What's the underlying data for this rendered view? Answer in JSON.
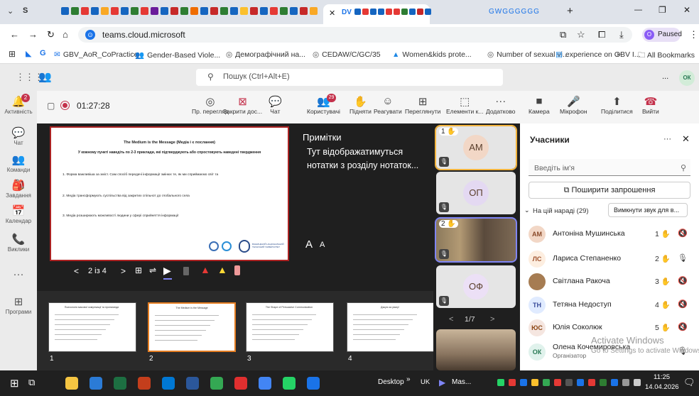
{
  "browser": {
    "url": "teams.cloud.microsoft",
    "paused_label": "Paused",
    "active_tab_initials": "DV",
    "tab_g_letters": "GWGGGGGG",
    "add_tab": "+",
    "win_min": "—",
    "win_max": "❐",
    "win_close": "✕",
    "bookmarks": [
      "GBV_AoR_CoPractice",
      "Gender-Based Viole...",
      "Демографічний на...",
      "CEDAW/C/GC/35",
      "Women&kids prote...",
      "Number of sexual vi...",
      "experience on GBV I..."
    ],
    "bookmarks_more": "»",
    "all_bookmarks": "All Bookmarks"
  },
  "teams": {
    "search_placeholder": "Пошук (Ctrl+Alt+E)",
    "more": "...",
    "profile_initials": "ОК"
  },
  "rail": [
    {
      "icon": "bell-icon",
      "glyph": "🔔",
      "label": "Активність",
      "badge": "2"
    },
    {
      "icon": "chat-icon",
      "glyph": "💬",
      "label": "Чат"
    },
    {
      "icon": "teams-icon",
      "glyph": "👥",
      "label": "Команди"
    },
    {
      "icon": "assignments-icon",
      "glyph": "🎒",
      "label": "Завдання"
    },
    {
      "icon": "calendar-icon",
      "glyph": "📅",
      "label": "Календар"
    },
    {
      "icon": "calls-icon",
      "glyph": "📞",
      "label": "Виклики"
    },
    {
      "icon": "more-icon",
      "glyph": "···",
      "label": ""
    },
    {
      "icon": "apps-icon",
      "glyph": "⊞",
      "label": "Програми"
    }
  ],
  "meeting": {
    "timer": "01:27:28",
    "buttons": [
      {
        "name": "viewer-mode",
        "glyph": "◎",
        "label": "Пр. перегляд"
      },
      {
        "name": "close-share",
        "glyph": "⊠",
        "label": "Закрити дос..."
      },
      {
        "name": "chat",
        "glyph": "💬",
        "label": "Чат"
      },
      {
        "name": "people",
        "glyph": "👥",
        "label": "Користувачі",
        "badge": "29"
      },
      {
        "name": "raise-hand",
        "glyph": "✋",
        "label": "Підняти"
      },
      {
        "name": "react",
        "glyph": "☺",
        "label": "Реагувати"
      },
      {
        "name": "view",
        "glyph": "⊞",
        "label": "Переглянути"
      },
      {
        "name": "elements",
        "glyph": "⬚",
        "label": "Елементи к..."
      },
      {
        "name": "more",
        "glyph": "···",
        "label": "Додатково"
      },
      {
        "name": "camera",
        "glyph": "■",
        "label": "Камера"
      },
      {
        "name": "mic",
        "glyph": "🎤",
        "label": "Мікрофон"
      },
      {
        "name": "share",
        "glyph": "⬆",
        "label": "Поділитися"
      },
      {
        "name": "leave",
        "glyph": "☎",
        "label": "Вийти"
      }
    ]
  },
  "slide": {
    "title": "The Medium is the Message (Медіа і є послання)",
    "subtitle": "У кожному пункті наведіть по 2-3 приклади, які підтверджують або спростовують наведені твердження",
    "point1": "1. Форма важливіша за зміст. Сам спосіб передачі інформації змінює те, як ми сприймаємо світ та",
    "point2": "2. Медіа трансформують суспільства від закритих спільнот до глобального села",
    "point3": "3. Медіа розширюють можливості людини у сфері сприйняття інформації",
    "logo_text": "ВІННИЦЬКИЙ НАЦІОНАЛЬНИЙ ТЕХНІЧНИЙ УНІВЕРСИТЕТ"
  },
  "notes": {
    "heading": "Примітки",
    "body": "Тут відображатимуться нотатки з розділу нотаток...",
    "font_up": "A",
    "font_down": "A"
  },
  "nav": {
    "page": "2 із 4",
    "prev": "<",
    "next": ">"
  },
  "thumbs": [
    {
      "num": "1",
      "title": "Психологія масової комунікації та пропаганди"
    },
    {
      "num": "2",
      "title": "The Medium is the Message"
    },
    {
      "num": "3",
      "title": "The Shape of Persuasive Communication"
    },
    {
      "num": "4",
      "title": "Дякую за увагу!"
    }
  ],
  "tiles": [
    {
      "initials": "АМ",
      "hand": "1",
      "color": "#f2d7c6"
    },
    {
      "initials": "ОП",
      "color": "#e4d9f2"
    },
    {
      "initials": "",
      "hand": "2",
      "video": true
    },
    {
      "initials": "ОФ",
      "color": "#ece0f6"
    }
  ],
  "tiles_nav": {
    "page": "1/7",
    "prev": "<",
    "next": ">"
  },
  "people": {
    "title": "Учасники",
    "search_placeholder": "Введіть ім'я",
    "share_invite": "Поширити запрошення",
    "section": "На цій нараді (29)",
    "mute_all": "Вимкнути звук для в...",
    "list": [
      {
        "initials": "АМ",
        "name": "Антоніна Мушинська",
        "hand": "1",
        "mic": "muted",
        "avbg": "#f2d7c6",
        "avfg": "#8a4a2a"
      },
      {
        "initials": "ЛС",
        "name": "Лариса Степаненко",
        "hand": "2",
        "mic": "on",
        "avbg": "#fdeee0",
        "avfg": "#a0522d"
      },
      {
        "initials": "",
        "name": "Світлана Ракоча",
        "hand": "3",
        "mic": "muted",
        "avbg": "#a67c52",
        "avfg": "#fff"
      },
      {
        "initials": "ТН",
        "name": "Тетяна Недоступ",
        "hand": "4",
        "mic": "muted",
        "avbg": "#e0ebff",
        "avfg": "#3a4c9a"
      },
      {
        "initials": "ЮС",
        "name": "Юлія Соколюк",
        "hand": "5",
        "mic": "muted",
        "avbg": "#f5e6e0",
        "avfg": "#8b4513"
      },
      {
        "initials": "ОК",
        "name": "Олена Кочемировська",
        "sub": "Організатор",
        "mic": "on",
        "avbg": "#e0f2ec",
        "avfg": "#2a7a55"
      }
    ]
  },
  "watermark": {
    "line1": "Activate Windows",
    "line2": "Go to Settings to activate Windows."
  },
  "taskbar": {
    "desktop": "Desktop",
    "chev": "»",
    "lang": "UK",
    "mas": "Mas...",
    "time": "11:25",
    "date": "14.04.2026"
  }
}
